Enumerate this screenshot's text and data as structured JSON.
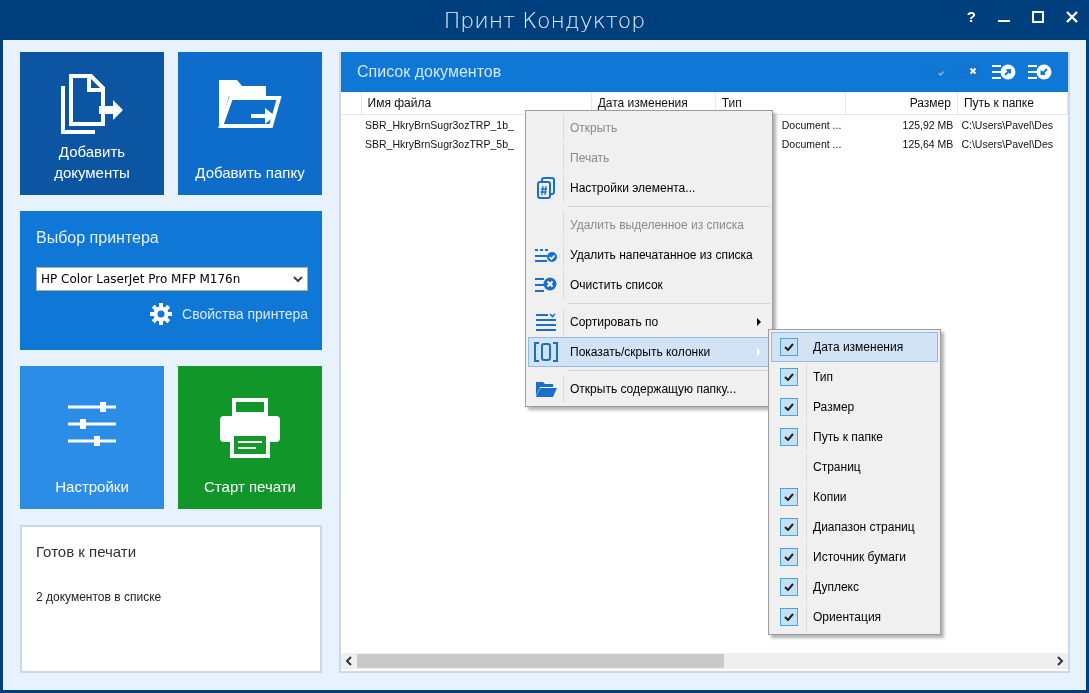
{
  "window": {
    "title": "Принт Кондуктор",
    "help": "?"
  },
  "tiles_top": [
    {
      "kind": "documents",
      "label": "Добавить документы"
    },
    {
      "kind": "folder",
      "label": "Добавить папку"
    }
  ],
  "printer": {
    "title": "Выбор принтера",
    "value": "HP Color LaserJet Pro MFP M176n",
    "properties": "Свойства принтера"
  },
  "tiles_bottom": [
    {
      "kind": "settings",
      "label": "Настройки"
    },
    {
      "kind": "print",
      "label": "Старт печати"
    }
  ],
  "status": {
    "title": "Готов к печати",
    "text": "2 документов в списке"
  },
  "documents": {
    "title": "Список документов",
    "columns": [
      "Имя файла",
      "Дата изменения",
      "Тип",
      "Размер",
      "Путь к папке"
    ],
    "rows": [
      [
        "SBR_HkryBrnSugr3ozTRP_1b_",
        "",
        "Document ...",
        "125,92 MB",
        "C:\\Users\\Pavel\\Des"
      ],
      [
        "SBR_HkryBrnSugr3ozTRP_5b_",
        "",
        "Document ...",
        "125,64 MB",
        "C:\\Users\\Pavel\\Des"
      ]
    ]
  },
  "context_menu": [
    {
      "kind": "item",
      "label": "Открыть",
      "disabled": true,
      "highlighted": false
    },
    {
      "kind": "item",
      "label": "Печать",
      "disabled": true,
      "highlighted": false
    },
    {
      "kind": "item",
      "label": "Настройки элемента...",
      "disabled": false,
      "highlighted": false
    },
    {
      "kind": "separator"
    },
    {
      "kind": "item",
      "label": "Удалить выделенное из списка",
      "disabled": true,
      "highlighted": false
    },
    {
      "kind": "item",
      "label": "Удалить напечатанное из списка",
      "disabled": false,
      "highlighted": false
    },
    {
      "kind": "item",
      "label": "Очистить список",
      "disabled": false,
      "highlighted": false
    },
    {
      "kind": "separator"
    },
    {
      "kind": "submenu",
      "label": "Сортировать по",
      "disabled": false,
      "highlighted": false
    },
    {
      "kind": "submenu",
      "label": "Показать/скрыть колонки",
      "disabled": false,
      "highlighted": true
    },
    {
      "kind": "separator"
    },
    {
      "kind": "item",
      "label": "Открыть содержащую папку...",
      "disabled": false,
      "highlighted": false
    }
  ],
  "columns_menu": [
    {
      "label": "Дата изменения",
      "checked": true,
      "highlighted": true
    },
    {
      "label": "Тип",
      "checked": true,
      "highlighted": false
    },
    {
      "label": "Размер",
      "checked": true,
      "highlighted": false
    },
    {
      "label": "Путь к папке",
      "checked": true,
      "highlighted": false
    },
    {
      "label": "Страниц",
      "checked": false,
      "highlighted": false
    },
    {
      "label": "Копии",
      "checked": true,
      "highlighted": false
    },
    {
      "label": "Диапазон страниц",
      "checked": true,
      "highlighted": false
    },
    {
      "label": "Источник бумаги",
      "checked": true,
      "highlighted": false
    },
    {
      "label": "Дуплекс",
      "checked": true,
      "highlighted": false
    },
    {
      "label": "Ориентация",
      "checked": true,
      "highlighted": false
    }
  ]
}
